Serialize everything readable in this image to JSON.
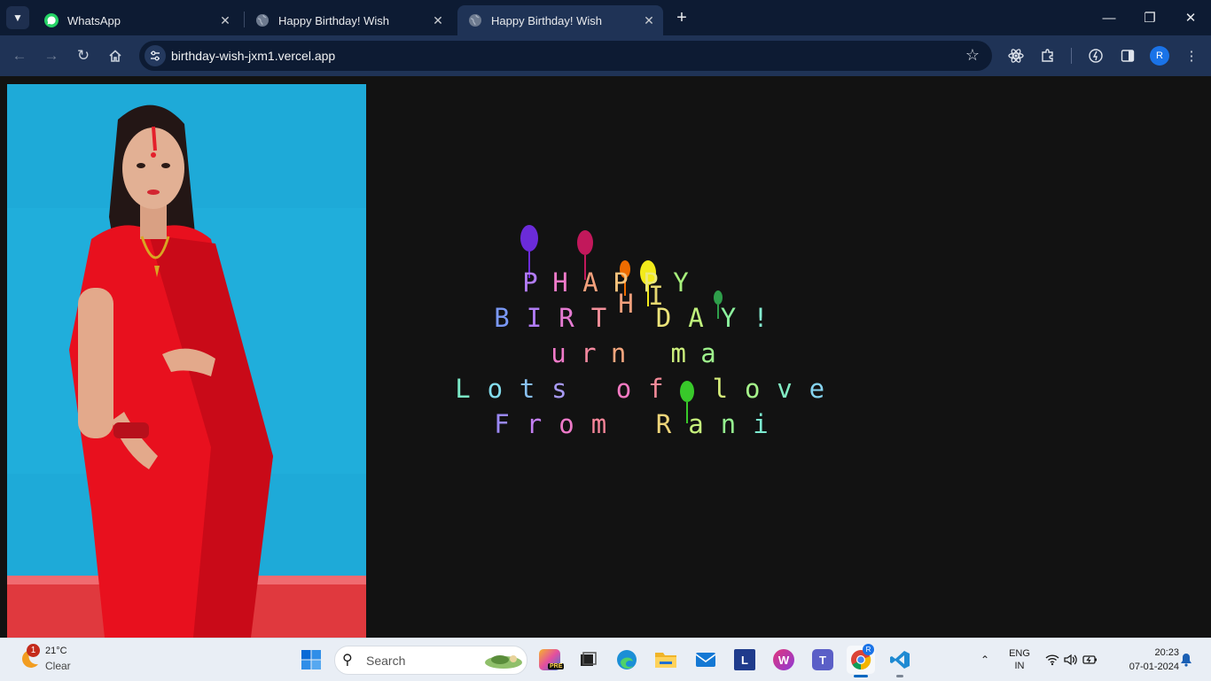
{
  "browser": {
    "tabs": [
      {
        "title": "WhatsApp",
        "icon": "whatsapp-icon",
        "active": false
      },
      {
        "title": "Happy Birthday! Wish",
        "icon": "globe-icon",
        "active": false
      },
      {
        "title": "Happy Birthday! Wish",
        "icon": "globe-icon",
        "active": true
      }
    ],
    "url": "birthday-wish-jxm1.vercel.app",
    "profile_initial": "R",
    "accent": "#1f3356"
  },
  "page": {
    "photo_alt": "Woman in red saree",
    "wish_lines": [
      {
        "text": "PHAPPY",
        "colors": [
          "#b27cf4",
          "#f07ac9",
          "#f3a07c",
          "#f7c27c",
          "#ebe97a",
          "#a7f07c"
        ]
      },
      {
        "text": "BIRT DAY!",
        "colors": [
          "#7a98f5",
          "#b07cf3",
          "#e57bd2",
          "#f38f9a",
          "#f4b37f",
          "#ece47a",
          "#bff07c",
          "#8cf29e",
          "#84ecd0"
        ]
      },
      {
        "text": "urn ma",
        "colors": [
          "#f07ac9",
          "#f3889f",
          "#f4a67e",
          "#efd57a",
          "#ccef7c",
          "#9ef28c"
        ]
      },
      {
        "text": "Lots of love",
        "colors": [
          "#7be8c6",
          "#83dcec",
          "#88c0f4",
          "#a89af5",
          "#d57cef",
          "#f37ac2",
          "#f58a98",
          "#f2c27c",
          "#d6ed7a",
          "#a5f28a",
          "#82ecc4",
          "#85d3ef"
        ]
      },
      {
        "text": "From Rani",
        "colors": [
          "#9a88f5",
          "#c37ef2",
          "#ee7ac9",
          "#f58599",
          "#f4a57e",
          "#eed57a",
          "#c6f07c",
          "#95f08f",
          "#7cebd0"
        ]
      }
    ],
    "overlay_letters": "HI",
    "balloons": [
      {
        "color": "#6b2bd9"
      },
      {
        "color": "#c2185b"
      },
      {
        "color": "#ef6c00"
      },
      {
        "color": "#f2ea1b"
      },
      {
        "color": "#2e9e4a"
      },
      {
        "color": "#38c92a"
      }
    ]
  },
  "taskbar": {
    "weather_temp": "21°C",
    "weather_cond": "Clear",
    "weather_badge": "1",
    "search_placeholder": "Search",
    "apps": [
      {
        "name": "copilot",
        "label": "PRE"
      },
      {
        "name": "task-view",
        "label": ""
      },
      {
        "name": "edge",
        "label": ""
      },
      {
        "name": "file-explorer",
        "label": ""
      },
      {
        "name": "mail",
        "label": ""
      },
      {
        "name": "l-app",
        "label": "L"
      },
      {
        "name": "wps-office",
        "label": "W"
      },
      {
        "name": "teams",
        "label": "T"
      },
      {
        "name": "chrome",
        "label": ""
      },
      {
        "name": "vscode",
        "label": ""
      }
    ],
    "lang_top": "ENG",
    "lang_bottom": "IN",
    "time": "20:23",
    "date": "07-01-2024"
  }
}
